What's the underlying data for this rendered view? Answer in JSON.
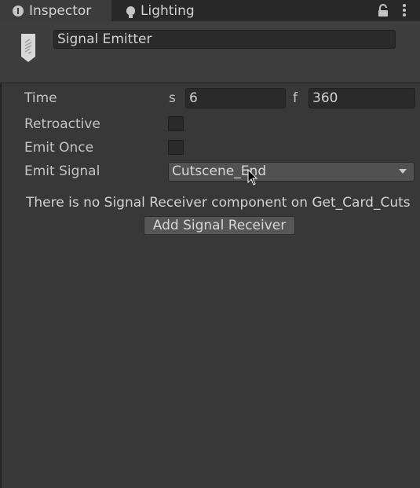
{
  "tabs": [
    {
      "label": "Inspector",
      "icon": "info-icon"
    },
    {
      "label": "Lighting",
      "icon": "bulb-icon"
    }
  ],
  "header": {
    "component_name": "Signal Emitter",
    "component_icon": "signal-emitter-icon"
  },
  "fields": {
    "time_label": "Time",
    "seconds_unit": "s",
    "seconds_value": "6",
    "frames_unit": "f",
    "frames_value": "360",
    "retroactive_label": "Retroactive",
    "retroactive_checked": false,
    "emit_once_label": "Emit Once",
    "emit_once_checked": false,
    "emit_signal_label": "Emit Signal",
    "emit_signal_value": "Cutscene_End"
  },
  "message": "There is no Signal Receiver component on Get_Card_Cuts",
  "add_button_label": "Add Signal Receiver",
  "colors": {
    "background": "#383838",
    "tab_bar": "#282828",
    "field_bg": "#2a2a2a",
    "button_bg": "#565656"
  }
}
